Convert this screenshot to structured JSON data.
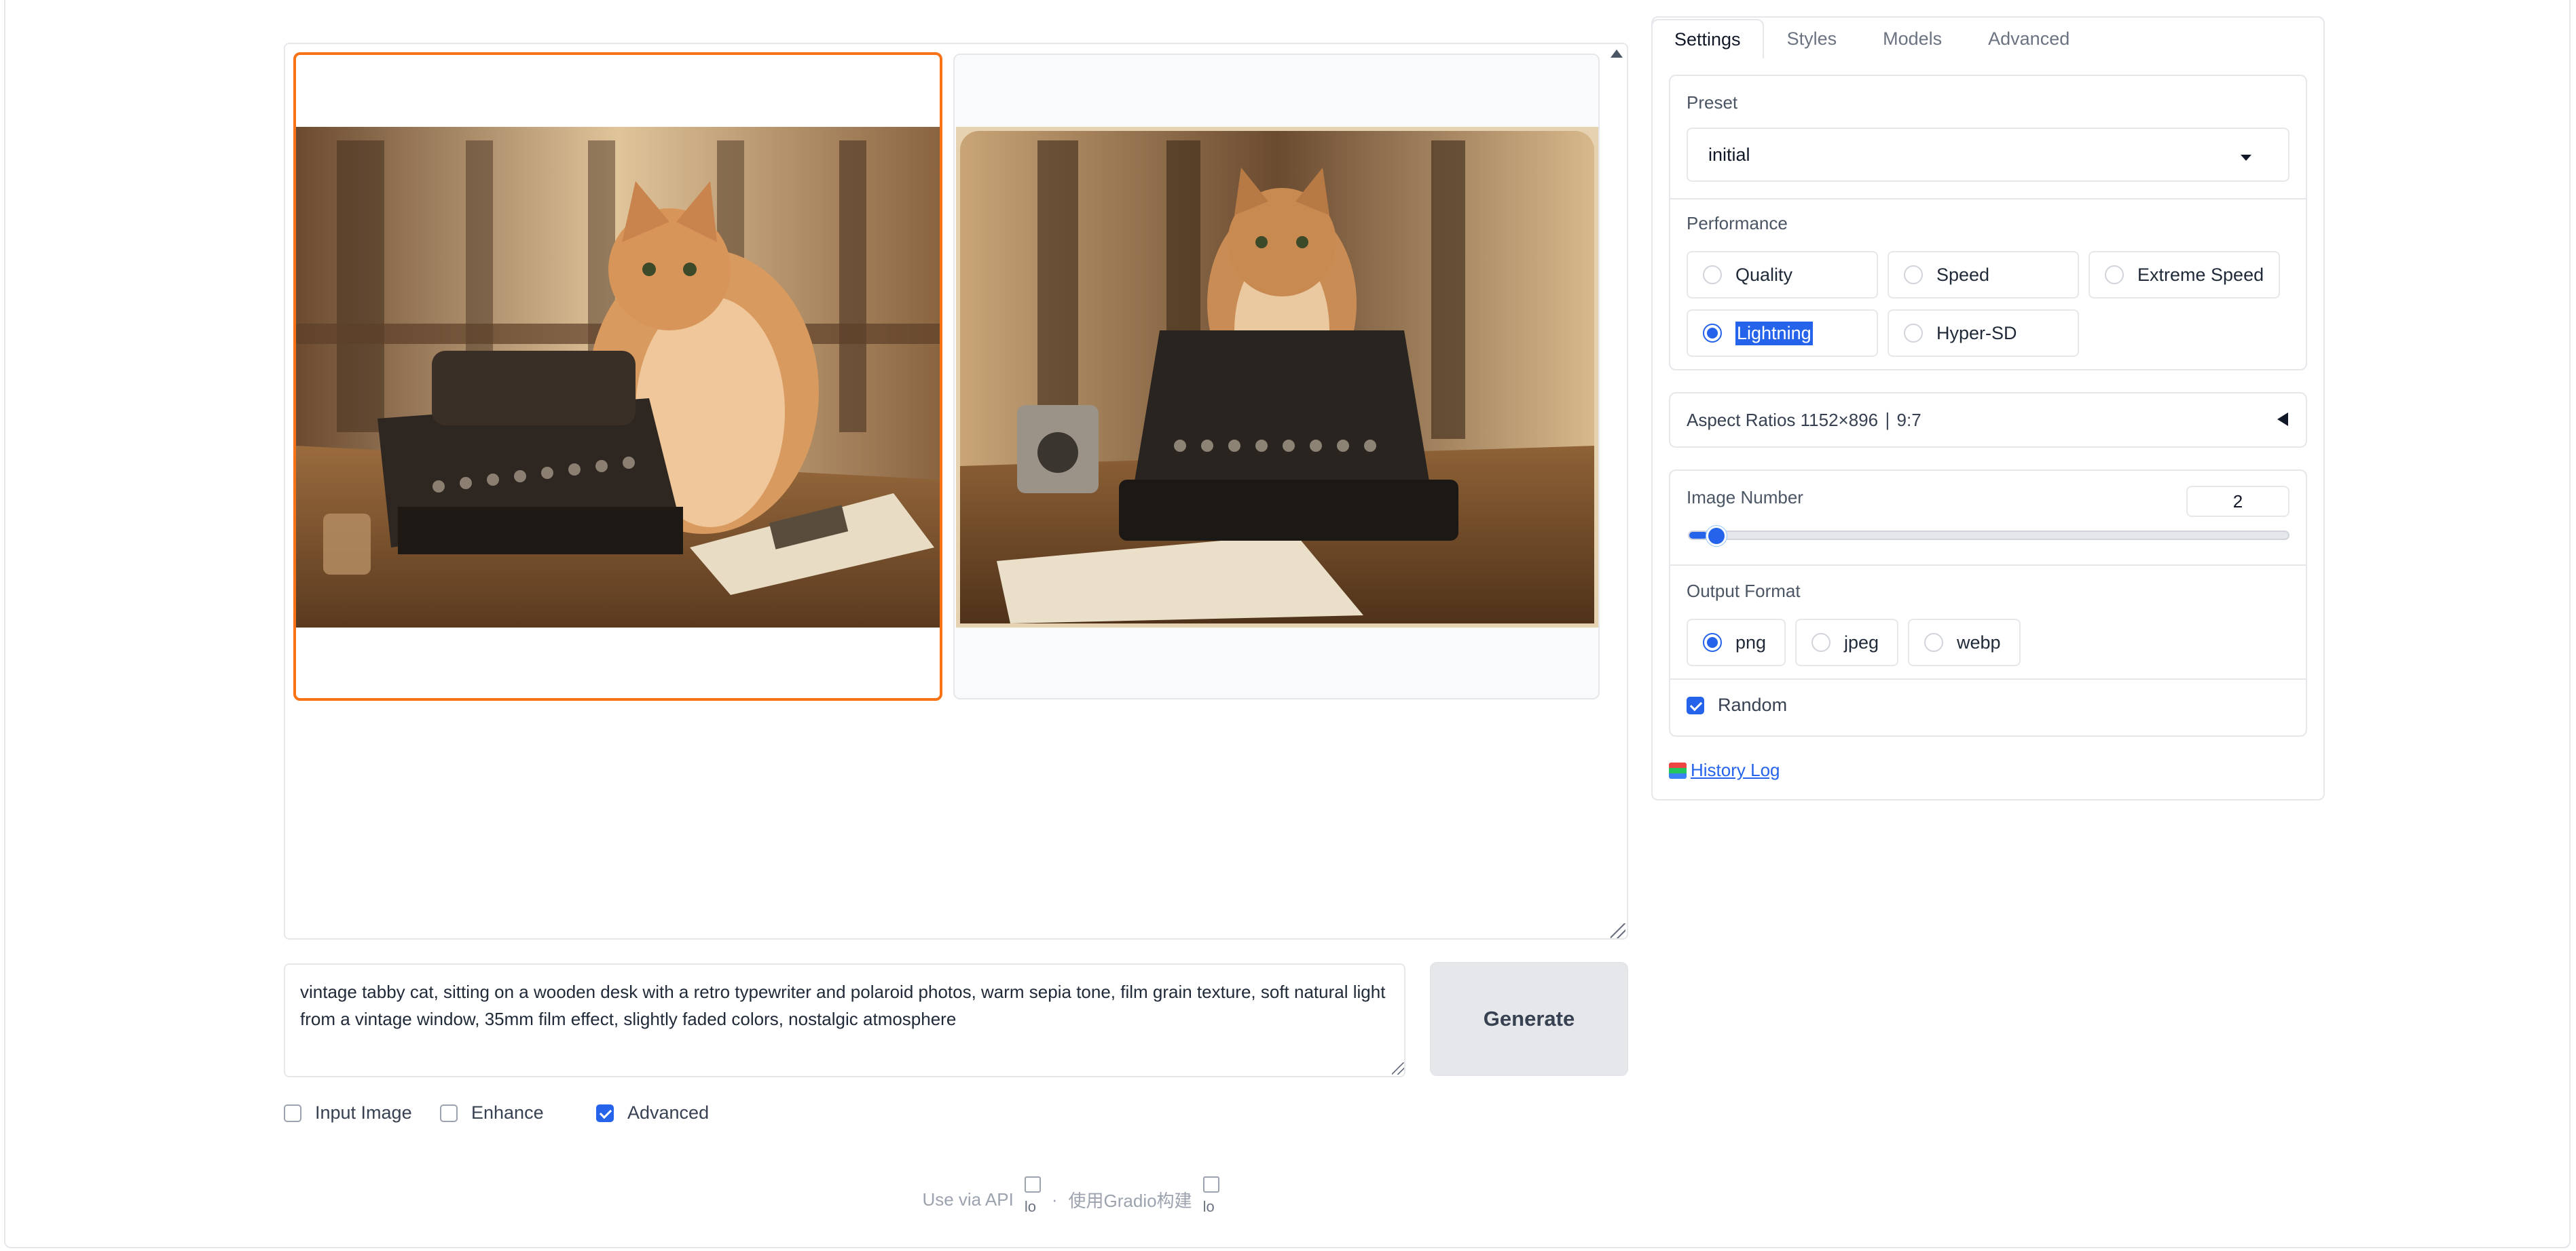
{
  "gallery": {
    "images": [
      {
        "description": "vintage cat with typewriter (selected)",
        "selected": true
      },
      {
        "description": "vintage cat sitting on typewriter",
        "selected": false
      }
    ]
  },
  "prompt": {
    "text": "vintage tabby cat, sitting on a wooden desk with a retro typewriter and polaroid photos, warm sepia tone, film grain texture, soft natural light from a vintage window, 35mm film effect, slightly faded colors, nostalgic atmosphere"
  },
  "generate_label": "Generate",
  "options": {
    "input_image": {
      "label": "Input Image",
      "checked": false
    },
    "enhance": {
      "label": "Enhance",
      "checked": false
    },
    "advanced": {
      "label": "Advanced",
      "checked": true
    }
  },
  "footer": {
    "api_text": "Use via API",
    "separator": "·",
    "built_with": "使用Gradio构建",
    "logo_alt": "lo"
  },
  "tabs": [
    "Settings",
    "Styles",
    "Models",
    "Advanced"
  ],
  "settings": {
    "preset_label": "Preset",
    "preset_value": "initial",
    "performance_label": "Performance",
    "performance_options": [
      "Quality",
      "Speed",
      "Extreme Speed",
      "Lightning",
      "Hyper-SD"
    ],
    "performance_selected": "Lightning",
    "aspect_ratio_text": "Aspect Ratios 1152×896 ∣ 9:7",
    "image_number_label": "Image Number",
    "image_number_value": "2",
    "image_number_fraction": 0.03,
    "output_format_label": "Output Format",
    "output_formats": [
      "png",
      "jpeg",
      "webp"
    ],
    "output_format_selected": "png",
    "random_label": "Random",
    "random_checked": true,
    "history_log_label": "History Log"
  },
  "colors": {
    "accent": "#2563eb",
    "selected_border": "#f97316"
  }
}
